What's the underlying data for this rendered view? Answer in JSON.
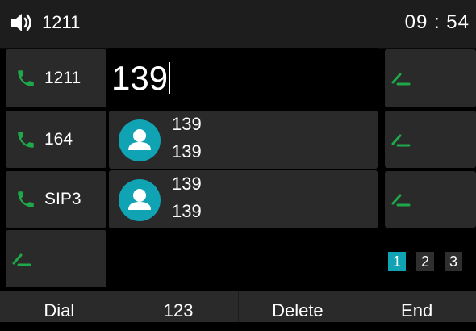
{
  "statusbar": {
    "icon": "speaker-icon",
    "extension": "1211",
    "time": "09 : 54"
  },
  "left_keys": [
    {
      "label": "1211",
      "icon": "phone-icon"
    },
    {
      "label": "164",
      "icon": "phone-icon"
    },
    {
      "label": "SIP3",
      "icon": "phone-icon"
    },
    {
      "label": "",
      "icon": "pen-icon"
    }
  ],
  "right_keys": [
    {
      "label": "",
      "icon": "pen-icon"
    },
    {
      "label": "",
      "icon": "pen-icon"
    },
    {
      "label": "",
      "icon": "pen-icon"
    }
  ],
  "dial_input": {
    "value": "139"
  },
  "search_results": [
    {
      "name": "139",
      "number": "139",
      "icon": "contact-avatar-icon"
    },
    {
      "name": "139",
      "number": "139",
      "icon": "contact-avatar-icon"
    }
  ],
  "pagination": {
    "pages": [
      "1",
      "2",
      "3"
    ],
    "active": "1"
  },
  "softkeys": {
    "dial": "Dial",
    "mode": "123",
    "delete": "Delete",
    "end": "End"
  },
  "colors": {
    "accent": "#0fa3b4",
    "line_icon": "#1fa84a",
    "tile": "#2a2a2a",
    "background": "#000000"
  }
}
